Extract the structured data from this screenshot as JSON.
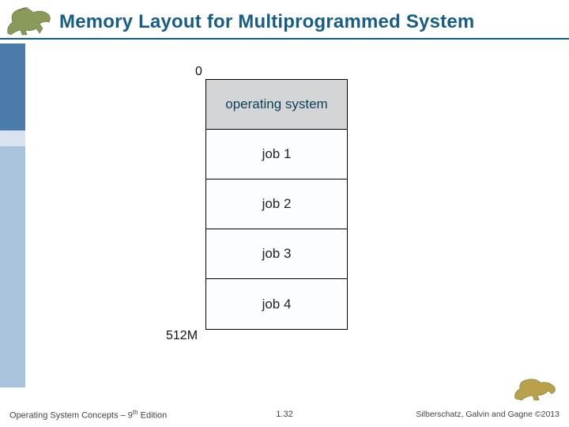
{
  "header": {
    "title": "Memory Layout for Multiprogrammed System"
  },
  "figure": {
    "start_address": "0",
    "end_address": "512M",
    "rows": [
      {
        "label": "operating system",
        "is_os": true
      },
      {
        "label": "job 1",
        "is_os": false
      },
      {
        "label": "job 2",
        "is_os": false
      },
      {
        "label": "job 3",
        "is_os": false
      },
      {
        "label": "job 4",
        "is_os": false
      }
    ]
  },
  "footer": {
    "left_prefix": "Operating System Concepts – 9",
    "left_sup": "th",
    "left_suffix": " Edition",
    "center": "1.32",
    "right": "Silberschatz, Galvin and Gagne ©2013"
  },
  "decor": {
    "dino_left_name": "dinosaur-illustration-top-left",
    "dino_right_name": "dinosaur-illustration-bottom-right",
    "accent_color": "#175e87"
  }
}
